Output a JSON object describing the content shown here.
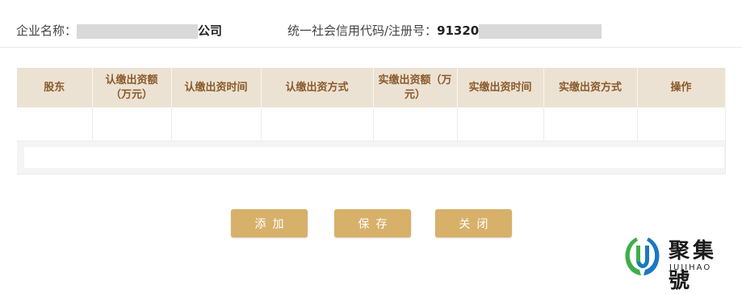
{
  "header": {
    "company_label": "企业名称：",
    "company_suffix": "公司",
    "credit_label": "统一社会信用代码/注册号：",
    "credit_prefix": "91320"
  },
  "table": {
    "columns": [
      "股东",
      "认缴出资额（万元）",
      "认缴出资时间",
      "认缴出资方式",
      "实缴出资额（万元）",
      "实缴出资时间",
      "实缴出资方式",
      "操作"
    ]
  },
  "buttons": {
    "add": "添加",
    "save": "保存",
    "close": "关闭"
  },
  "watermark": {
    "cn": "聚集號",
    "en": "JUJIHAO",
    "colors": {
      "green": "#3fae49",
      "blue": "#1c78c0"
    }
  }
}
